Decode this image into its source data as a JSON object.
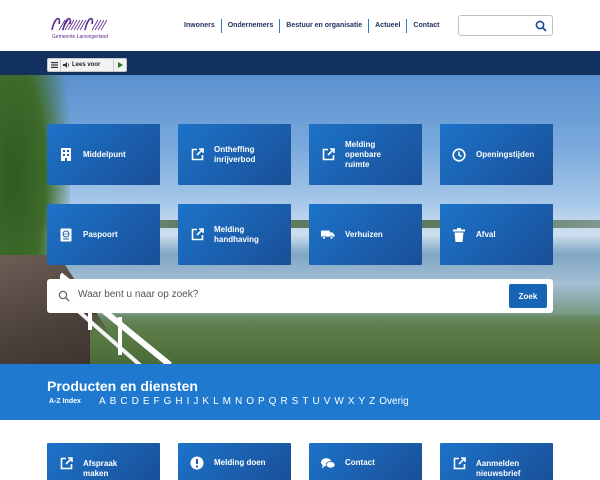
{
  "header": {
    "logo_text": "Gemeente Lansingerland",
    "nav": [
      "Inwoners",
      "Ondernemers",
      "Bestuur en organisatie",
      "Actueel",
      "Contact"
    ],
    "search_placeholder": ""
  },
  "readspeaker": {
    "label": "Lees voor"
  },
  "tiles": [
    {
      "label": "Middelpunt",
      "icon": "building-icon"
    },
    {
      "label": "Ontheffing inrijverbod",
      "icon": "external-link-icon"
    },
    {
      "label": "Melding openbare ruimte",
      "icon": "external-link-icon"
    },
    {
      "label": "Openingstijden",
      "icon": "clock-icon"
    },
    {
      "label": "Paspoort",
      "icon": "passport-icon"
    },
    {
      "label": "Melding handhaving",
      "icon": "external-link-icon"
    },
    {
      "label": "Verhuizen",
      "icon": "truck-icon"
    },
    {
      "label": "Afval",
      "icon": "trash-icon"
    }
  ],
  "search": {
    "placeholder": "Waar bent u naar op zoek?",
    "button": "Zoek"
  },
  "products": {
    "title": "Producten en diensten",
    "az_label": "A-Z Index",
    "letters": [
      "A",
      "B",
      "C",
      "D",
      "E",
      "F",
      "G",
      "H",
      "I",
      "J",
      "K",
      "L",
      "M",
      "N",
      "O",
      "P",
      "Q",
      "R",
      "S",
      "T",
      "U",
      "V",
      "W",
      "X",
      "Y",
      "Z",
      "Overig"
    ]
  },
  "bottom_tiles": [
    {
      "label": "Afspraak maken",
      "icon": "external-link-icon"
    },
    {
      "label": "Melding doen",
      "icon": "alert-icon"
    },
    {
      "label": "Contact",
      "icon": "chat-icon"
    },
    {
      "label": "Aanmelden nieuwsbrief",
      "icon": "external-link-icon"
    }
  ],
  "colors": {
    "navy": "#12315f",
    "tile": "#1a5fae",
    "band": "#1e79cf"
  }
}
